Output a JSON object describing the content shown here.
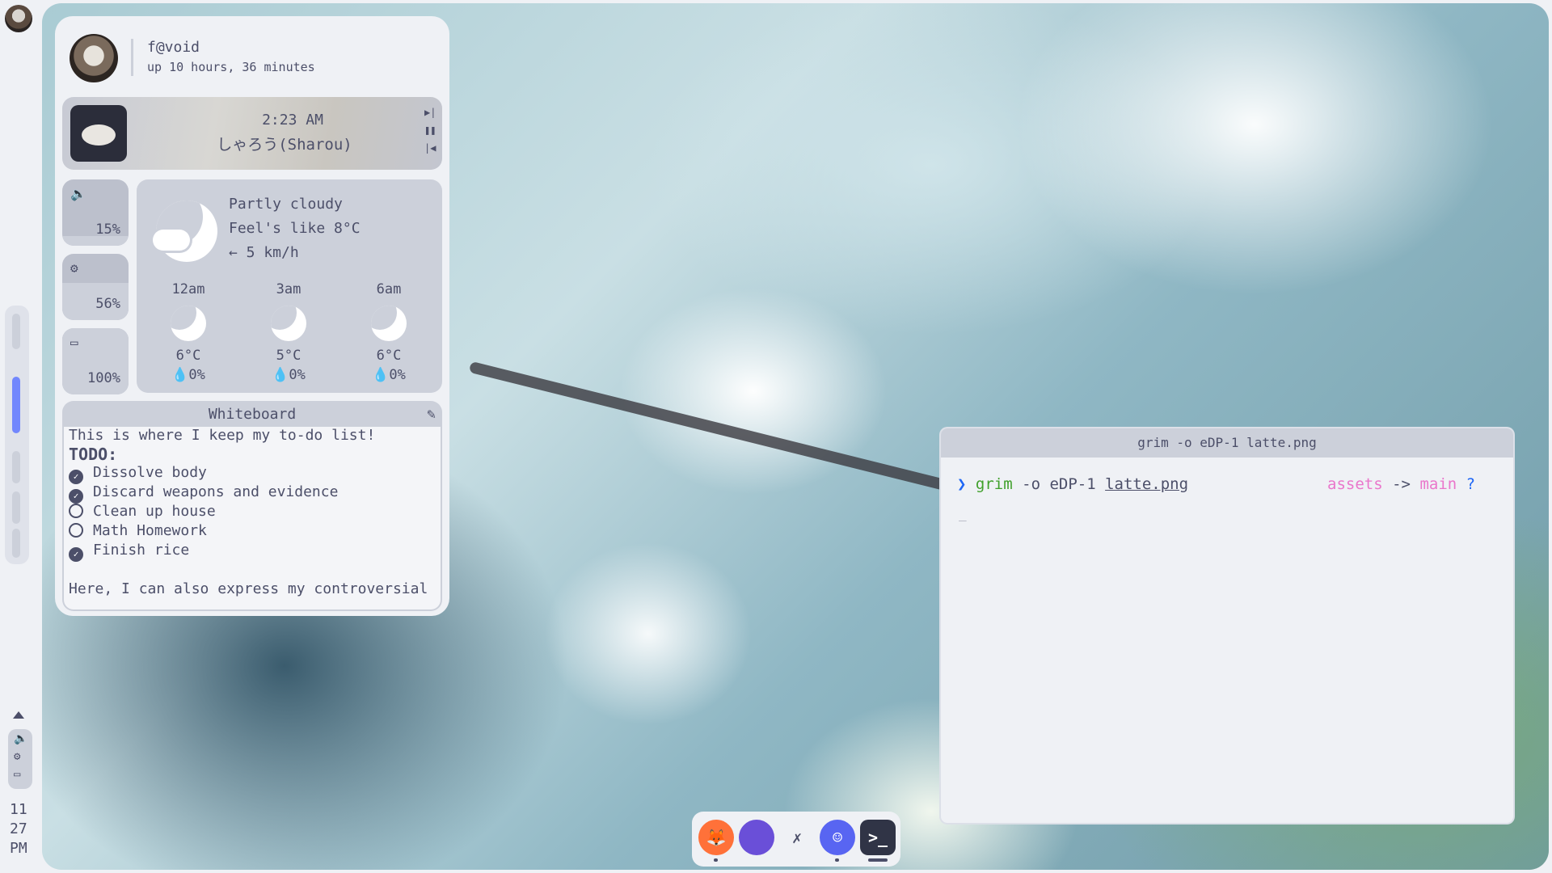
{
  "profile": {
    "user": "f@void",
    "uptime": "up 10 hours, 36 minutes"
  },
  "media": {
    "time": "2:23 AM",
    "title": "しゃろう(Sharou)",
    "next_icon": "skip-next",
    "pause_icon": "pause",
    "prev_icon": "skip-previous"
  },
  "quick_settings": [
    {
      "name": "volume",
      "icon": "speaker-icon",
      "glyph": "🔈",
      "value": "15%",
      "level": 0.15
    },
    {
      "name": "brightness",
      "icon": "sun-icon",
      "glyph": "⚙",
      "value": "56%",
      "level": 0.56
    },
    {
      "name": "battery",
      "icon": "battery-icon",
      "glyph": "▭",
      "value": "100%",
      "level": 1.0
    }
  ],
  "weather": {
    "condition": "Partly cloudy",
    "feels_like": "Feel's like 8°C",
    "wind": "← 5 km/h",
    "forecast": [
      {
        "time": "12am",
        "temp": "6°C",
        "rain": "💧0%"
      },
      {
        "time": "3am",
        "temp": "5°C",
        "rain": "💧0%"
      },
      {
        "time": "6am",
        "temp": "6°C",
        "rain": "💧0%"
      }
    ]
  },
  "whiteboard": {
    "title": "Whiteboard",
    "intro": "This is where I keep my to-do list!",
    "todo_heading": "TODO:",
    "items": [
      {
        "label": "Dissolve body",
        "done": true
      },
      {
        "label": "Discard weapons and evidence",
        "done": true
      },
      {
        "label": "Clean up house",
        "done": false
      },
      {
        "label": "Math Homework",
        "done": false
      },
      {
        "label": "Finish rice",
        "done": true
      }
    ],
    "footer": "Here, I can also express my controversial"
  },
  "terminal": {
    "title": "grim -o eDP-1 latte.png",
    "prompt_symbol": "❯",
    "command": "grim",
    "args": "-o eDP-1",
    "file": "latte.png",
    "dir": "assets",
    "sep": "->",
    "branch": "main",
    "status": "?",
    "cursor": "_"
  },
  "sidebar_clock": {
    "hour": "11",
    "minute": "27",
    "ampm": "PM"
  },
  "dock": [
    {
      "name": "firefox",
      "color": "#ff7139"
    },
    {
      "name": "purple-app",
      "color": "#6a4fd8"
    },
    {
      "name": "tool-app",
      "color": "#4c4f69"
    },
    {
      "name": "discord",
      "color": "#5865f2"
    },
    {
      "name": "terminal",
      "color": "#303446"
    }
  ],
  "colors": {
    "accent": "#7287fd",
    "base": "#eff1f5",
    "surface": "#ccd0da",
    "text": "#4c4f69"
  }
}
